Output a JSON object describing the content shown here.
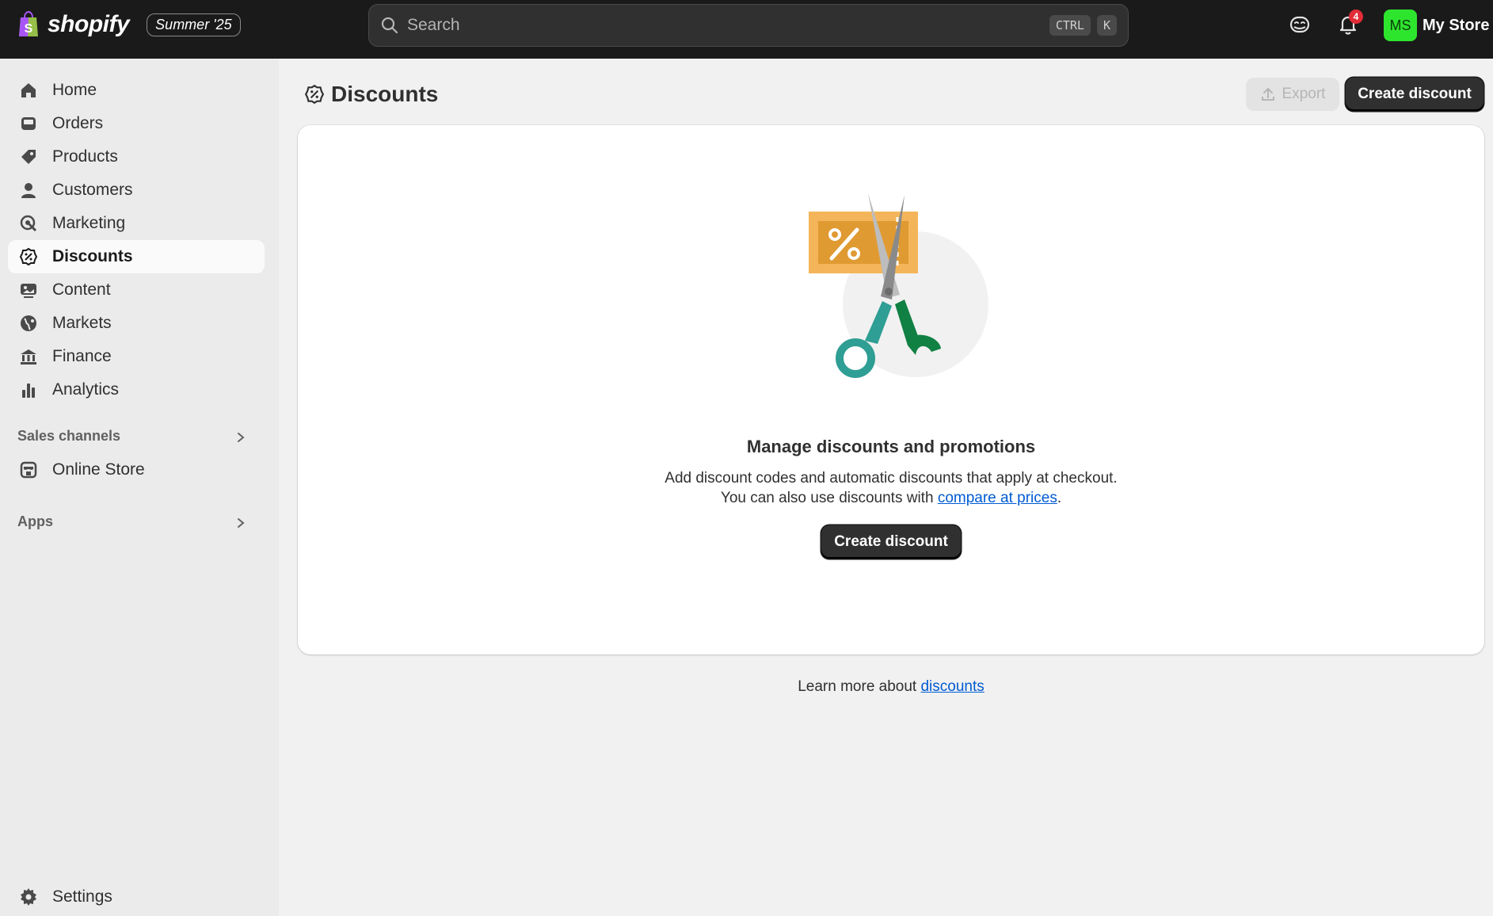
{
  "topbar": {
    "brand": "shopify",
    "edition_badge": "Summer '25",
    "search": {
      "placeholder": "Search",
      "shortcut_keys": [
        "CTRL",
        "K"
      ]
    },
    "notification_count": "4",
    "avatar_initials": "MS",
    "store_name": "My Store",
    "accent_color": "#2ee52e"
  },
  "sidebar": {
    "items": [
      {
        "label": "Home",
        "icon": "home-icon"
      },
      {
        "label": "Orders",
        "icon": "inbox-icon"
      },
      {
        "label": "Products",
        "icon": "tag-icon"
      },
      {
        "label": "Customers",
        "icon": "person-icon"
      },
      {
        "label": "Marketing",
        "icon": "target-icon"
      },
      {
        "label": "Discounts",
        "icon": "discount-badge-icon",
        "active": true
      },
      {
        "label": "Content",
        "icon": "image-icon"
      },
      {
        "label": "Markets",
        "icon": "globe-icon"
      },
      {
        "label": "Finance",
        "icon": "bank-icon"
      },
      {
        "label": "Analytics",
        "icon": "bar-chart-icon"
      }
    ],
    "sales_channels": {
      "label": "Sales channels",
      "items": [
        {
          "label": "Online Store",
          "icon": "store-icon"
        }
      ]
    },
    "apps": {
      "label": "Apps"
    },
    "settings": {
      "label": "Settings",
      "icon": "gear-icon"
    }
  },
  "main": {
    "title": "Discounts",
    "export_label": "Export",
    "create_label": "Create discount",
    "empty_state": {
      "heading": "Manage discounts and promotions",
      "line1": "Add discount codes and automatic discounts that apply at checkout.",
      "line2_prefix": "You can also use discounts with ",
      "line2_link": "compare at prices",
      "line2_suffix": ".",
      "button_label": "Create discount"
    },
    "learn_more_prefix": "Learn more about ",
    "learn_more_link": "discounts"
  }
}
